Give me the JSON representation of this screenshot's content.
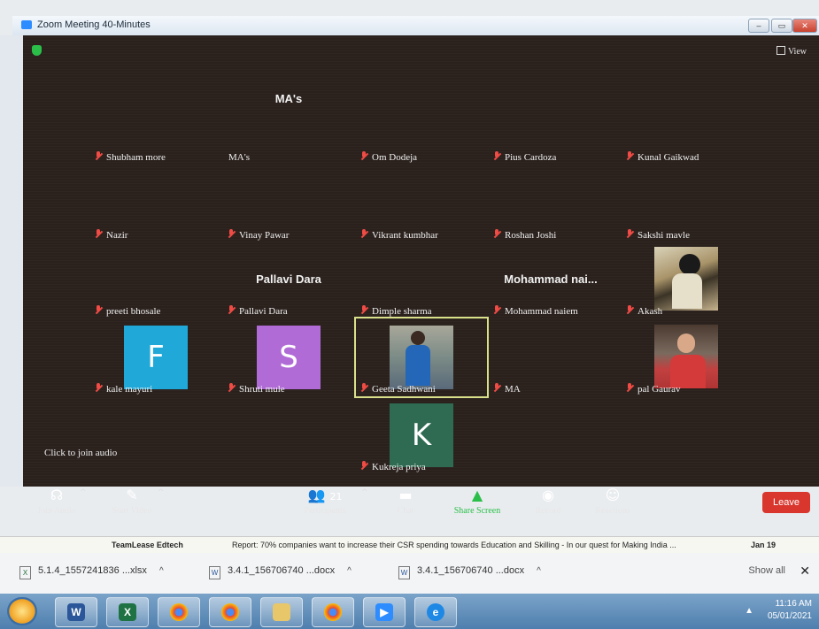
{
  "window": {
    "title": "Zoom Meeting 40-Minutes",
    "min": "‒",
    "max": "▭",
    "close": "✕"
  },
  "view_label": "View",
  "participants": [
    {
      "id": "mas",
      "display_big": "MA's",
      "label": "MA's",
      "muted": false
    },
    {
      "id": "shubham",
      "label": "Shubham more",
      "muted": true
    },
    {
      "id": "om",
      "label": "Om Dodeja",
      "muted": true
    },
    {
      "id": "pius",
      "label": "Pius Cardoza",
      "muted": true
    },
    {
      "id": "kunal",
      "label": "Kunal Gaikwad",
      "muted": true
    },
    {
      "id": "nazir",
      "label": "Nazir",
      "muted": true
    },
    {
      "id": "vinay",
      "label": "Vinay Pawar",
      "muted": true
    },
    {
      "id": "vikrant",
      "label": "Vikrant kumbhar",
      "muted": true
    },
    {
      "id": "roshan",
      "label": "Roshan Joshi",
      "muted": true
    },
    {
      "id": "sakshi",
      "label": "Sakshi mavle",
      "muted": true
    },
    {
      "id": "preeti",
      "label": "preeti bhosale",
      "muted": true
    },
    {
      "id": "pallavi",
      "display_big": "Pallavi Dara",
      "label": "Pallavi Dara",
      "muted": true
    },
    {
      "id": "dimple",
      "label": "Dimple sharma",
      "muted": true
    },
    {
      "id": "mohammad",
      "display_big": "Mohammad nai...",
      "label": "Mohammad naiem",
      "muted": true
    },
    {
      "id": "akash",
      "label": "Akash",
      "muted": true
    },
    {
      "id": "kale",
      "avatar_letter": "F",
      "avatar_color": "#1fa8d8",
      "label": "kale mayuri",
      "muted": true
    },
    {
      "id": "shruti",
      "avatar_letter": "S",
      "avatar_color": "#b06bd6",
      "label": "Shruti mule",
      "muted": true
    },
    {
      "id": "geeta",
      "label": "Geeta Sadhwani",
      "muted": true
    },
    {
      "id": "ma",
      "label": "MA",
      "muted": true
    },
    {
      "id": "pal",
      "label": "pal Gaurav",
      "muted": true
    },
    {
      "id": "kukreja",
      "avatar_letter": "K",
      "avatar_color": "#2e6b52",
      "label": "Kukreja priya",
      "muted": true
    }
  ],
  "click_to_join_audio": "Click to join audio",
  "toolbar": {
    "join_audio": "Join Audio",
    "start_video": "Start Video",
    "participants": "Participants",
    "participants_count": "21",
    "chat": "Chat",
    "share_screen": "Share Screen",
    "record": "Record",
    "reactions": "Reactions",
    "leave": "Leave"
  },
  "newsbar": {
    "source": "TeamLease Edtech",
    "headline": "Report: 70% companies want to increase their CSR spending towards Education and Skilling - In our quest for Making India ...",
    "date": "Jan 19"
  },
  "downloads": [
    {
      "name": "5.1.4_1557241836 ...xlsx",
      "type": "xlsx"
    },
    {
      "name": "3.4.1_156706740 ...docx",
      "type": "docx"
    },
    {
      "name": "3.4.1_156706740 ...docx",
      "type": "docx"
    }
  ],
  "downloads_show_all": "Show all",
  "taskbar": {
    "apps": [
      "word-icon",
      "excel-icon",
      "chrome-icon",
      "chrome-profile-icon",
      "file-explorer-icon",
      "chrome-profile-icon-2",
      "zoom-icon",
      "internet-explorer-icon"
    ],
    "time": "11:16 AM",
    "date": "05/01/2021"
  },
  "colors": {
    "accent_green": "#2bbf4a",
    "leave_red": "#d9372e",
    "mute_red": "#f04b45",
    "active_speaker": "#d8e08a"
  }
}
